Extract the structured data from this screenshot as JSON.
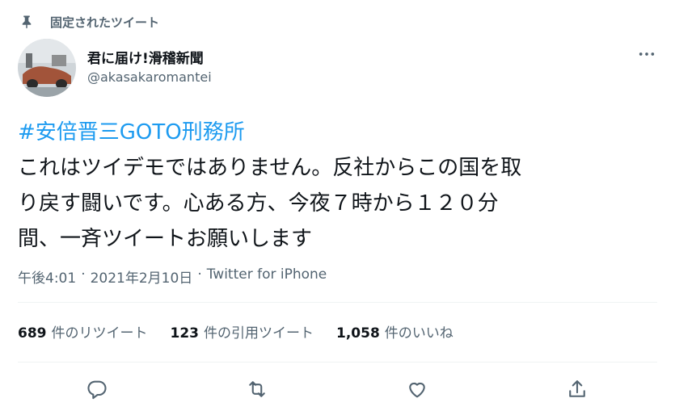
{
  "pinned": {
    "label": "固定されたツイート",
    "icon": "pin-icon"
  },
  "author": {
    "display_name": "君に届け!滑稽新聞",
    "handle": "@akasakaromantei"
  },
  "tweet": {
    "hashtag": "#安倍晋三GOTO刑務所",
    "body": "これはツイデモではありません。反社からこの国を取\nり戻す闘いです。心ある方、今夜７時から１２０分\n間、一斉ツイートお願いします"
  },
  "meta": {
    "time": "午後4:01",
    "separator": "·",
    "date": "2021年2月10日",
    "source": "Twitter for iPhone"
  },
  "stats": [
    {
      "count": "689",
      "label": "件のリツイート"
    },
    {
      "count": "123",
      "label": "件の引用ツイート"
    },
    {
      "count": "1,058",
      "label": "件のいいね"
    }
  ],
  "actions": [
    {
      "icon": "reply-icon"
    },
    {
      "icon": "retweet-icon"
    },
    {
      "icon": "like-icon"
    },
    {
      "icon": "share-icon"
    }
  ],
  "colors": {
    "accent": "#1d9bf0",
    "secondary_text": "#536471",
    "primary_text": "#0f1419",
    "divider": "#eff3f4"
  }
}
